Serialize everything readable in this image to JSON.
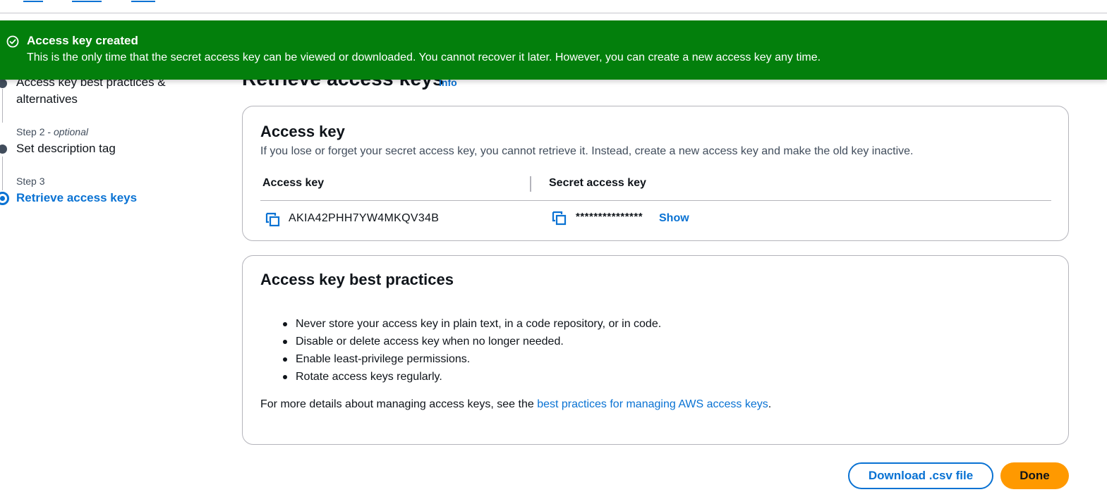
{
  "flash": {
    "title": "Access key created",
    "message": "This is the only time that the secret access key can be viewed or downloaded. You cannot recover it later. However, you can create a new access key any time.",
    "icon": "check-circle-icon",
    "color": "#037f0c"
  },
  "page": {
    "title": "Retrieve access keys",
    "info": "Info"
  },
  "steps": [
    {
      "label": "Access key best practices & alternatives"
    },
    {
      "small": "Step 2",
      "optional": "optional",
      "label": "Set description tag"
    },
    {
      "small": "Step 3",
      "label": "Retrieve access keys"
    }
  ],
  "access_key_card": {
    "title": "Access key",
    "description": "If you lose or forget your secret access key, you cannot retrieve it. Instead, create a new access key and make the old key inactive.",
    "col_access_key": "Access key",
    "col_secret_key": "Secret access key",
    "access_key_value": "AKIA42PHH7YW4MKQV34B",
    "secret_masked": "***************",
    "show_label": "Show"
  },
  "best_practices": {
    "title": "Access key best practices",
    "items": [
      "Never store your access key in plain text, in a code repository, or in code.",
      "Disable or delete access key when no longer needed.",
      "Enable least-privilege permissions.",
      "Rotate access keys regularly."
    ],
    "more_prefix": "For more details about managing access keys, see the ",
    "more_link": "best practices for managing AWS access keys",
    "more_suffix": "."
  },
  "buttons": {
    "download": "Download .csv file",
    "done": "Done"
  },
  "colors": {
    "link": "#0972d3",
    "primary": "#ff9900",
    "success": "#037f0c"
  }
}
